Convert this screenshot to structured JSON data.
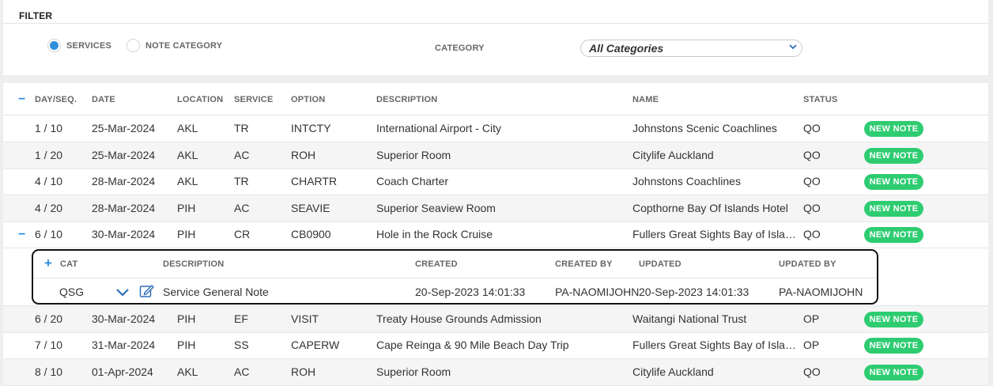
{
  "filter": {
    "title": "FILTER",
    "radio_services": "SERVICES",
    "radio_note_category": "NOTE CATEGORY",
    "category_label": "CATEGORY",
    "category_value": "All Categories"
  },
  "grid": {
    "headers": {
      "dayseq": "DAY/SEQ.",
      "date": "DATE",
      "location": "LOCATION",
      "service": "SERVICE",
      "option": "OPTION",
      "description": "DESCRIPTION",
      "name": "NAME",
      "status": "STATUS"
    },
    "new_note_label": "NEW NOTE",
    "rows": [
      {
        "dayseq": "1 / 10",
        "date": "25-Mar-2024",
        "location": "AKL",
        "service": "TR",
        "option": "INTCTY",
        "description": "International Airport - City",
        "name": "Johnstons Scenic Coachlines",
        "status": "QO"
      },
      {
        "dayseq": "1 / 20",
        "date": "25-Mar-2024",
        "location": "AKL",
        "service": "AC",
        "option": "ROH",
        "description": "Superior Room",
        "name": "Citylife Auckland",
        "status": "QO"
      },
      {
        "dayseq": "4 / 10",
        "date": "28-Mar-2024",
        "location": "AKL",
        "service": "TR",
        "option": "CHARTR",
        "description": "Coach Charter",
        "name": "Johnstons Coachlines",
        "status": "QO"
      },
      {
        "dayseq": "4 / 20",
        "date": "28-Mar-2024",
        "location": "PIH",
        "service": "AC",
        "option": "SEAVIE",
        "description": "Superior Seaview Room",
        "name": "Copthorne Bay Of Islands Hotel",
        "status": "QO"
      },
      {
        "dayseq": "6 / 10",
        "date": "30-Mar-2024",
        "location": "PIH",
        "service": "CR",
        "option": "CB0900",
        "description": "Hole in the Rock Cruise",
        "name": "Fullers Great Sights Bay of Islands",
        "status": "QO"
      },
      {
        "dayseq": "6 / 20",
        "date": "30-Mar-2024",
        "location": "PIH",
        "service": "EF",
        "option": "VISIT",
        "description": "Treaty House Grounds Admission",
        "name": "Waitangi National Trust",
        "status": "OP"
      },
      {
        "dayseq": "7 / 10",
        "date": "31-Mar-2024",
        "location": "PIH",
        "service": "SS",
        "option": "CAPERW",
        "description": "Cape Reinga & 90 Mile Beach Day Trip",
        "name": "Fullers Great Sights Bay of Islands",
        "status": "OP"
      },
      {
        "dayseq": "8 / 10",
        "date": "01-Apr-2024",
        "location": "AKL",
        "service": "AC",
        "option": "ROH",
        "description": "Superior Room",
        "name": "Citylife Auckland",
        "status": "QO"
      }
    ]
  },
  "subgrid": {
    "headers": {
      "cat": "CAT",
      "description": "DESCRIPTION",
      "created": "CREATED",
      "created_by": "CREATED BY",
      "updated": "UPDATED",
      "updated_by": "UPDATED BY"
    },
    "row": {
      "cat": "QSG",
      "description": "Service General Note",
      "created": "20-Sep-2023 14:01:33",
      "created_by": "PA-NAOMIJOHN",
      "updated": "20-Sep-2023 14:01:33",
      "updated_by": "PA-NAOMIJOHN"
    }
  },
  "colors": {
    "accent": "#2f8fdc",
    "badge": "#2ecc71",
    "row_alt": "#f5f5f5"
  }
}
